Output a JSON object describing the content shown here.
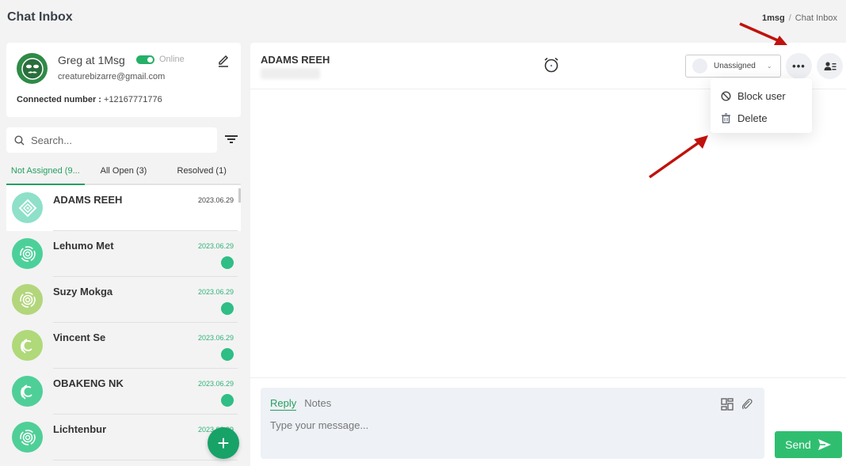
{
  "page": {
    "title": "Chat Inbox",
    "breadcrumb": {
      "root": "1msg",
      "separator": "/",
      "current": "Chat Inbox"
    }
  },
  "profile": {
    "name": "Greg at 1Msg",
    "status_label": "Online",
    "status_on": true,
    "email": "creaturebizarre@gmail.com",
    "connected_label": "Connected number :",
    "connected_number": "+12167771776",
    "avatar_color": "#2f8a47"
  },
  "search": {
    "placeholder": "Search...",
    "value": ""
  },
  "tabs": [
    {
      "label": "Not Assigned (9...",
      "active": true
    },
    {
      "label": "All Open (3)",
      "active": false
    },
    {
      "label": "Resolved (1)",
      "active": false
    }
  ],
  "conversations": [
    {
      "name": "ADAMS REEH",
      "date": "2023.06.29",
      "unread": false,
      "selected": true,
      "avatar_color": "#8ee0c9",
      "avatar_icon": "diamond-icon"
    },
    {
      "name": "Lehumo Met",
      "date": "2023.06.29",
      "unread": true,
      "selected": false,
      "avatar_color": "#4cd09a",
      "avatar_icon": "rings-icon"
    },
    {
      "name": "Suzy Mokga",
      "date": "2023.06.29",
      "unread": true,
      "selected": false,
      "avatar_color": "#b3d67c",
      "avatar_icon": "rings-icon"
    },
    {
      "name": "Vincent Se",
      "date": "2023.06.29",
      "unread": true,
      "selected": false,
      "avatar_color": "#b0d97a",
      "avatar_icon": "arcs-icon"
    },
    {
      "name": "OBAKENG NK",
      "date": "2023.06.29",
      "unread": true,
      "selected": false,
      "avatar_color": "#4fcf98",
      "avatar_icon": "arcs-icon"
    },
    {
      "name": "Lichtenbur",
      "date": "2023.06.29",
      "unread": false,
      "selected": false,
      "avatar_color": "#4fcf98",
      "avatar_icon": "rings-icon"
    }
  ],
  "fab": {
    "label": "+"
  },
  "chat": {
    "contact_name": "ADAMS REEH",
    "assignee": "Unassigned",
    "more_label": "•••",
    "menu": [
      {
        "label": "Block user",
        "icon": "block-icon"
      },
      {
        "label": "Delete",
        "icon": "trash-icon"
      }
    ],
    "composer": {
      "tabs": [
        {
          "label": "Reply",
          "active": true
        },
        {
          "label": "Notes",
          "active": false
        }
      ],
      "placeholder": "Type your message...",
      "value": ""
    },
    "send_label": "Send"
  },
  "colors": {
    "accent": "#25a05f",
    "send": "#2fbe70",
    "fab": "#17a268",
    "annotation_arrow": "#c0120c"
  }
}
